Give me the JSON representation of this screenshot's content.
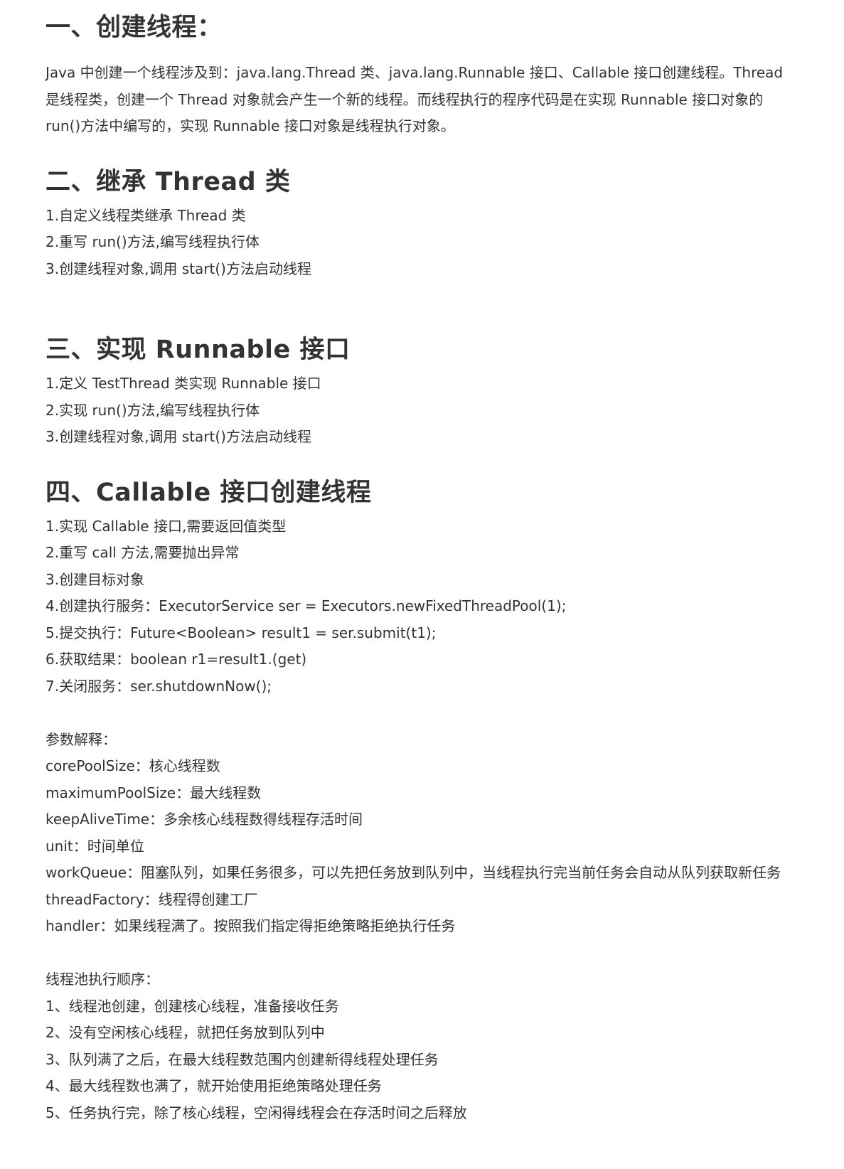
{
  "sections": [
    {
      "title": "一、创建线程：",
      "paragraph": "Java 中创建一个线程涉及到：java.lang.Thread 类、java.lang.Runnable 接口、Callable 接口创建线程。Thread 是线程类，创建一个 Thread 对象就会产生一个新的线程。而线程执行的程序代码是在实现 Runnable 接口对象的 run()方法中编写的，实现 Runnable 接口对象是线程执行对象。"
    },
    {
      "title": "二、继承 Thread 类",
      "items": [
        "1.自定义线程类继承 Thread 类",
        "2.重写 run()方法,编写线程执行体",
        "3.创建线程对象,调用 start()方法启动线程"
      ]
    },
    {
      "title": "三、实现 Runnable 接口",
      "items": [
        "1.定义 TestThread 类实现 Runnable 接口",
        "2.实现 run()方法,编写线程执行体",
        "3.创建线程对象,调用 start()方法启动线程"
      ]
    },
    {
      "title": "四、Callable 接口创建线程",
      "items": [
        "1.实现 Callable 接口,需要返回值类型",
        "2.重写 call 方法,需要抛出异常",
        "3.创建目标对象",
        "4.创建执行服务：ExecutorService ser = Executors.newFixedThreadPool(1);",
        "5.提交执行：Future<Boolean> result1 = ser.submit(t1);",
        "6.获取结果：boolean r1=result1.(get)",
        "7.关闭服务：ser.shutdownNow();"
      ]
    }
  ],
  "params": {
    "heading": "参数解释：",
    "items": [
      "corePoolSize：核心线程数",
      "maximumPoolSize：最大线程数",
      "keepAliveTime：多余核心线程数得线程存活时间",
      "unit：时间单位",
      "workQueue：阻塞队列，如果任务很多，可以先把任务放到队列中，当线程执行完当前任务会自动从队列获取新任务",
      "threadFactory：线程得创建工厂",
      "handler：如果线程满了。按照我们指定得拒绝策略拒绝执行任务"
    ]
  },
  "pool_order": {
    "heading": "线程池执行顺序：",
    "items": [
      "1、线程池创建，创建核心线程，准备接收任务",
      "2、没有空闲核心线程，就把任务放到队列中",
      "3、队列满了之后，在最大线程数范围内创建新得线程处理任务",
      "4、最大线程数也满了，就开始使用拒绝策略处理任务",
      "5、任务执行完，除了核心线程，空闲得线程会在存活时间之后释放"
    ]
  }
}
